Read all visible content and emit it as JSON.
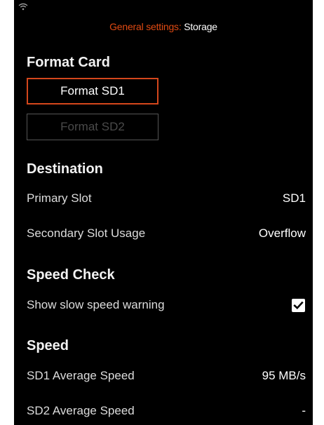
{
  "header": {
    "prefix": "General settings: ",
    "page": "Storage",
    "accent_color": "#e04a12"
  },
  "status_bar": {
    "icon": "wifi-icon"
  },
  "format_card": {
    "title": "Format Card",
    "format_sd1_label": "Format SD1",
    "format_sd2_label": "Format SD2",
    "format_sd2_enabled": false
  },
  "destination": {
    "title": "Destination",
    "primary_slot_label": "Primary Slot",
    "primary_slot_value": "SD1",
    "secondary_slot_label": "Secondary Slot Usage",
    "secondary_slot_value": "Overflow"
  },
  "speed_check": {
    "title": "Speed Check",
    "slow_warning_label": "Show slow speed warning",
    "slow_warning_checked": true,
    "check_icon": "checkmark-icon"
  },
  "speed": {
    "title": "Speed",
    "sd1_label": "SD1 Average Speed",
    "sd1_value": "95 MB/s",
    "sd2_label": "SD2 Average Speed",
    "sd2_value": "-"
  }
}
